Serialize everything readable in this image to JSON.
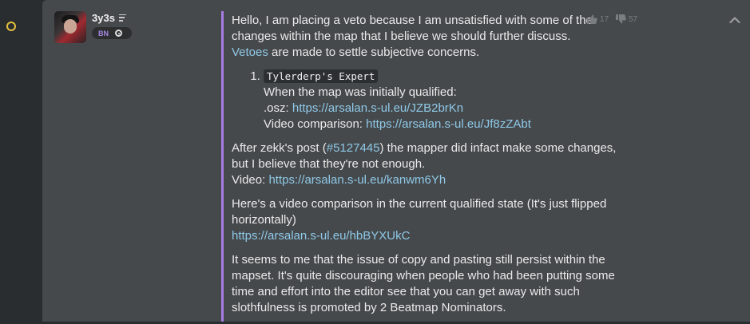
{
  "user": {
    "name": "3y3s",
    "badge": "BN"
  },
  "votes": {
    "up_count": "17",
    "down_count": "57"
  },
  "post": {
    "p1_text": "Hello, I am placing a veto because I am unsatisfied with some of the changes within the map that I believe we should further discuss.",
    "p1_link": "Vetoes",
    "p1_tail": " are made to settle subjective concerns.",
    "list": {
      "code": "Tylerderp's Expert",
      "line1": "When the map was initially qualified:",
      "osz_label": ".osz: ",
      "osz_link": "https://arsalan.s-ul.eu/JZB2brKn",
      "video_label": "Video comparison: ",
      "video_link": "https://arsalan.s-ul.eu/Jf8zZAbt"
    },
    "p2_pre": "After zekk's post (",
    "p2_link": "#5127445",
    "p2_post": ") the mapper did infact make some changes, but I believe that they're not enough.",
    "p2_video_label": "Video: ",
    "p2_video_link": "https://arsalan.s-ul.eu/kanwm6Yh",
    "p3_text": "Here's a video comparison in the current qualified state (It's just flipped horizontally)",
    "p3_link": "https://arsalan.s-ul.eu/hbBYXUkC",
    "p4_text": "It seems to me that the issue of copy and pasting still persist within the mapset. It's quite discouraging when people who had been putting some time and effort into the editor see that you can get away with such slothfulness is promoted by 2 Beatmap Nominators."
  },
  "colors": {
    "accent_bar": "#a77be2",
    "link": "#8ec9e9",
    "timeline_dot": "#e5c13d"
  },
  "icons": [
    "list-icon",
    "ring-icon",
    "thumbs-up-icon",
    "thumbs-down-icon",
    "chevron-up-icon"
  ]
}
